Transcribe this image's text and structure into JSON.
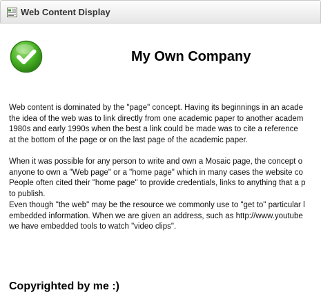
{
  "window": {
    "title": "Web Content Display",
    "icon": "web-content-display-icon"
  },
  "content": {
    "logo_icon": "green-checkmark-icon",
    "company_name": "My Own Company",
    "paragraphs": [
      {
        "lines": [
          "Web content is dominated by the \"page\" concept. Having its beginnings in an acade",
          "the idea of the web was to link directly from one academic paper to another academ",
          "1980s and early 1990s when the best a link could be made was to cite a reference",
          "at the bottom of the page or on the last page of the academic paper."
        ]
      },
      {
        "lines": [
          "When it was possible for any person to write and own a Mosaic page, the concept o",
          "anyone to own a \"Web page\" or a \"home page\" which in many cases the website co",
          "People often cited their \"home page\" to provide credentials, links to anything that a p",
          "to publish."
        ]
      },
      {
        "lines": [
          "Even though \"the web\" may be the resource we commonly use to \"get to\" particular l",
          "embedded information. When we are given an address, such as http://www.youtube",
          "we have embedded tools to watch \"video clips\"."
        ]
      }
    ],
    "footer": "Copyrighted by me :)"
  },
  "colors": {
    "titlebar_text": "#333333",
    "logo_green": "#3fae1f",
    "text": "#111111"
  }
}
